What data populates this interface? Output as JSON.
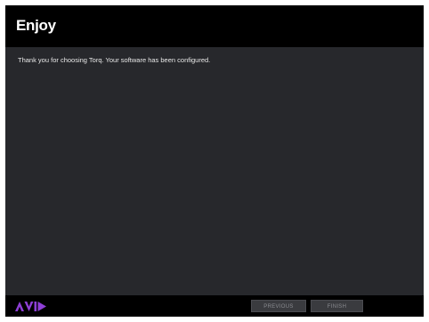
{
  "window": {
    "title": "Enjoy",
    "message": "Thank you for choosing Torq. Your software has been configured."
  },
  "footer": {
    "logo_icon": "avid-logo-icon",
    "brand_color": "#8a2be2",
    "previous_label": "PREVIOUS",
    "finish_label": "FINISH"
  }
}
